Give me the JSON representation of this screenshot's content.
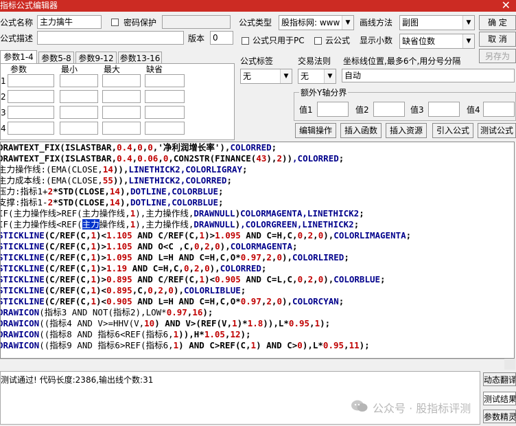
{
  "window": {
    "title": "指标公式编辑器",
    "close_glyph": "✕"
  },
  "form": {
    "name_label": "公式名称",
    "name_value": "主力擒牛",
    "password_label": "密码保护",
    "desc_label": "公式描述",
    "version_label": "版本",
    "version_value": "0",
    "type_label": "公式类型",
    "type_value": "股指标网: www",
    "draw_label": "画线方法",
    "draw_value": "副图",
    "pc_only_label": "公式只用于PC",
    "cloud_label": "云公式",
    "decimals_label": "显示小数",
    "decimals_value": "缺省位数"
  },
  "buttons": {
    "ok": "确 定",
    "cancel": "取 消",
    "save_as": "另存为"
  },
  "tabs": [
    "参数1-4",
    "参数5-8",
    "参数9-12",
    "参数13-16"
  ],
  "params": {
    "headers": [
      "参数",
      "最小",
      "最大",
      "缺省"
    ],
    "rows": [
      "1",
      "2",
      "3",
      "4"
    ]
  },
  "tag": {
    "label": "公式标签",
    "value": "无"
  },
  "trade": {
    "label": "交易法则",
    "value": "无"
  },
  "coords": {
    "label": "坐标线位置,最多6个,用分号分隔",
    "value": "自动"
  },
  "yaxis": {
    "label": "额外Y轴分界",
    "values": [
      "值1",
      "值2",
      "值3",
      "值4"
    ]
  },
  "actions": [
    "编辑操作",
    "插入函数",
    "插入资源",
    "引入公式",
    "测试公式"
  ],
  "code_lines": [
    [
      [
        "DRAWTEXT_FIX(ISLASTBAR,",
        "f"
      ],
      [
        "0.4",
        "n"
      ],
      [
        ",",
        "p"
      ],
      [
        "0",
        "n"
      ],
      [
        ",",
        "p"
      ],
      [
        "0",
        "n"
      ],
      [
        ",'净利润增长率'),",
        "p"
      ],
      [
        "COLORRED",
        "k"
      ],
      [
        ";",
        "p"
      ]
    ],
    [
      [
        "DRAWTEXT_FIX(ISLASTBAR,",
        "f"
      ],
      [
        "0.4",
        "n"
      ],
      [
        ",",
        "p"
      ],
      [
        "0.06",
        "n"
      ],
      [
        ",",
        "p"
      ],
      [
        "0",
        "n"
      ],
      [
        ",CON2STR(FINANCE(",
        "p"
      ],
      [
        "43",
        "n"
      ],
      [
        "),",
        "p"
      ],
      [
        "2",
        "n"
      ],
      [
        "))",
        "p"
      ],
      [
        ",COLORRED",
        "k"
      ],
      [
        ";",
        "p"
      ]
    ],
    [
      [
        "主力操作线:(EMA(CLOSE,",
        "v"
      ],
      [
        "14",
        "n"
      ],
      [
        ")),",
        "p"
      ],
      [
        "LINETHICK2,COLORLIGRAY",
        "k"
      ],
      [
        ";",
        "p"
      ]
    ],
    [
      [
        "主力成本线:(EMA(CLOSE,",
        "v"
      ],
      [
        "55",
        "n"
      ],
      [
        ")),",
        "p"
      ],
      [
        "LINETHICK2,COLORRED",
        "k"
      ],
      [
        ";",
        "p"
      ]
    ],
    [
      [
        "压力:指标1+",
        "v"
      ],
      [
        "2",
        "n"
      ],
      [
        "*STD(CLOSE,",
        "p"
      ],
      [
        "14",
        "n"
      ],
      [
        "),",
        "p"
      ],
      [
        "DOTLINE,COLORBLUE",
        "k"
      ],
      [
        ";",
        "p"
      ]
    ],
    [
      [
        "支撑:指标1-",
        "v"
      ],
      [
        "2",
        "n"
      ],
      [
        "*STD(CLOSE,",
        "p"
      ],
      [
        "14",
        "n"
      ],
      [
        "),",
        "p"
      ],
      [
        "DOTLINE,COLORBLUE",
        "k"
      ],
      [
        ";",
        "p"
      ]
    ],
    [
      [
        "IF(主力操作线>REF(主力操作线,",
        "v"
      ],
      [
        "1",
        "n"
      ],
      [
        "),主力操作线,",
        "v"
      ],
      [
        "DRAWNULL",
        "k"
      ],
      [
        ")",
        "p"
      ],
      [
        "COLORMAGENTA,LINETHICK2",
        "k"
      ],
      [
        ";",
        "p"
      ]
    ],
    [
      [
        "IF(主力操作线<REF(",
        "v"
      ],
      [
        "主力",
        "h"
      ],
      [
        "操作线,",
        "v"
      ],
      [
        "1",
        "n"
      ],
      [
        "),主力操作线,",
        "v"
      ],
      [
        "DRAWNULL",
        "k"
      ],
      [
        ")",
        "p"
      ],
      [
        ",COLORGREEN,LINETHICK2",
        "k"
      ],
      [
        ";",
        "p"
      ]
    ],
    [
      [
        "STICKLINE",
        "k"
      ],
      [
        "(C/REF(C,",
        "p"
      ],
      [
        "1",
        "n"
      ],
      [
        ")<",
        "p"
      ],
      [
        "1.105",
        "n"
      ],
      [
        " AND C/REF(C,",
        "p"
      ],
      [
        "1",
        "n"
      ],
      [
        ")>",
        "p"
      ],
      [
        "1.095",
        "n"
      ],
      [
        " AND C=H,C,",
        "p"
      ],
      [
        "0",
        "n"
      ],
      [
        ",",
        "p"
      ],
      [
        "2",
        "n"
      ],
      [
        ",",
        "p"
      ],
      [
        "0",
        "n"
      ],
      [
        "),",
        "p"
      ],
      [
        "COLORLIMAGENTA",
        "k"
      ],
      [
        ";",
        "p"
      ]
    ],
    [
      [
        "STICKLINE",
        "k"
      ],
      [
        "(C/REF(C,",
        "p"
      ],
      [
        "1",
        "n"
      ],
      [
        ")>",
        "p"
      ],
      [
        "1.105",
        "n"
      ],
      [
        " AND O<C ,C,",
        "p"
      ],
      [
        "0",
        "n"
      ],
      [
        ",",
        "p"
      ],
      [
        "2",
        "n"
      ],
      [
        ",",
        "p"
      ],
      [
        "0",
        "n"
      ],
      [
        "),",
        "p"
      ],
      [
        "COLORMAGENTA",
        "k"
      ],
      [
        ";",
        "p"
      ]
    ],
    [
      [
        "STICKLINE",
        "k"
      ],
      [
        "(C/REF(C,",
        "p"
      ],
      [
        "1",
        "n"
      ],
      [
        ")>",
        "p"
      ],
      [
        "1.095",
        "n"
      ],
      [
        " AND L=H AND C=H,C,O*",
        "p"
      ],
      [
        "0.97",
        "n"
      ],
      [
        ",",
        "p"
      ],
      [
        "2",
        "n"
      ],
      [
        ",",
        "p"
      ],
      [
        "0",
        "n"
      ],
      [
        "),",
        "p"
      ],
      [
        "COLORLIRED",
        "k"
      ],
      [
        ";",
        "p"
      ]
    ],
    [
      [
        "STICKLINE",
        "k"
      ],
      [
        "(C/REF(C,",
        "p"
      ],
      [
        "1",
        "n"
      ],
      [
        ")>",
        "p"
      ],
      [
        "1.19",
        "n"
      ],
      [
        " AND C=H,C,",
        "p"
      ],
      [
        "0",
        "n"
      ],
      [
        ",",
        "p"
      ],
      [
        "2",
        "n"
      ],
      [
        ",",
        "p"
      ],
      [
        "0",
        "n"
      ],
      [
        "),",
        "p"
      ],
      [
        "COLORRED",
        "k"
      ],
      [
        ";",
        "p"
      ]
    ],
    [
      [
        "STICKLINE",
        "k"
      ],
      [
        "(C/REF(C,",
        "p"
      ],
      [
        "1",
        "n"
      ],
      [
        ")>",
        "p"
      ],
      [
        "0.895",
        "n"
      ],
      [
        " AND C/REF(C,",
        "p"
      ],
      [
        "1",
        "n"
      ],
      [
        ")<",
        "p"
      ],
      [
        "0.905",
        "n"
      ],
      [
        " AND C=L,C,",
        "p"
      ],
      [
        "0",
        "n"
      ],
      [
        ",",
        "p"
      ],
      [
        "2",
        "n"
      ],
      [
        ",",
        "p"
      ],
      [
        "0",
        "n"
      ],
      [
        "),",
        "p"
      ],
      [
        "COLORBLUE",
        "k"
      ],
      [
        ";",
        "p"
      ]
    ],
    [
      [
        "STICKLINE",
        "k"
      ],
      [
        "(C/REF(C,",
        "p"
      ],
      [
        "1",
        "n"
      ],
      [
        ")<",
        "p"
      ],
      [
        "0.895",
        "n"
      ],
      [
        ",C,",
        "p"
      ],
      [
        "0",
        "n"
      ],
      [
        ",",
        "p"
      ],
      [
        "2",
        "n"
      ],
      [
        ",",
        "p"
      ],
      [
        "0",
        "n"
      ],
      [
        "),",
        "p"
      ],
      [
        "COLORLIBLUE",
        "k"
      ],
      [
        ";",
        "p"
      ]
    ],
    [
      [
        "STICKLINE",
        "k"
      ],
      [
        "(C/REF(C,",
        "p"
      ],
      [
        "1",
        "n"
      ],
      [
        ")<",
        "p"
      ],
      [
        "0.905",
        "n"
      ],
      [
        " AND L=H AND C=H,C,O*",
        "p"
      ],
      [
        "0.97",
        "n"
      ],
      [
        ",",
        "p"
      ],
      [
        "2",
        "n"
      ],
      [
        ",",
        "p"
      ],
      [
        "0",
        "n"
      ],
      [
        "),",
        "p"
      ],
      [
        "COLORCYAN",
        "k"
      ],
      [
        ";",
        "p"
      ]
    ],
    [
      [
        "DRAWICON",
        "k"
      ],
      [
        "(指标3 AND NOT(指标2),LOW*",
        "v"
      ],
      [
        "0.97",
        "n"
      ],
      [
        ",",
        "p"
      ],
      [
        "16",
        "n"
      ],
      [
        ");",
        "p"
      ]
    ],
    [
      [
        "DRAWICON",
        "k"
      ],
      [
        "((指标4 AND V>=HHV(V,",
        "v"
      ],
      [
        "10",
        "n"
      ],
      [
        ") AND V>(REF(V,",
        "p"
      ],
      [
        "1",
        "n"
      ],
      [
        ")*",
        "p"
      ],
      [
        "1.8",
        "n"
      ],
      [
        ")),L*",
        "p"
      ],
      [
        "0.95",
        "n"
      ],
      [
        ",",
        "p"
      ],
      [
        "1",
        "n"
      ],
      [
        ");",
        "p"
      ]
    ],
    [
      [
        "DRAWICON",
        "k"
      ],
      [
        "((指标8 AND 指标6<REF(指标6,",
        "v"
      ],
      [
        "1",
        "n"
      ],
      [
        "))",
        "p"
      ],
      [
        ",H*",
        "p"
      ],
      [
        "1.05",
        "n"
      ],
      [
        ",",
        "p"
      ],
      [
        "12",
        "n"
      ],
      [
        ");",
        "p"
      ]
    ],
    [
      [
        "DRAWICON",
        "k"
      ],
      [
        "((指标9 AND 指标6>REF(指标6,",
        "v"
      ],
      [
        "1",
        "n"
      ],
      [
        ") AND C>REF(C,",
        "p"
      ],
      [
        "1",
        "n"
      ],
      [
        ") AND C>",
        "p"
      ],
      [
        "0",
        "n"
      ],
      [
        "),L*",
        "p"
      ],
      [
        "0.95",
        "n"
      ],
      [
        ",",
        "p"
      ],
      [
        "11",
        "n"
      ],
      [
        ");",
        "p"
      ]
    ]
  ],
  "status": {
    "message": "测试通过! 代码长度:2386,输出线个数:31",
    "watermark": "公众号 · 股指标评测"
  },
  "right_panel": [
    "动态翻译",
    "测试结果",
    "参数精灵"
  ]
}
